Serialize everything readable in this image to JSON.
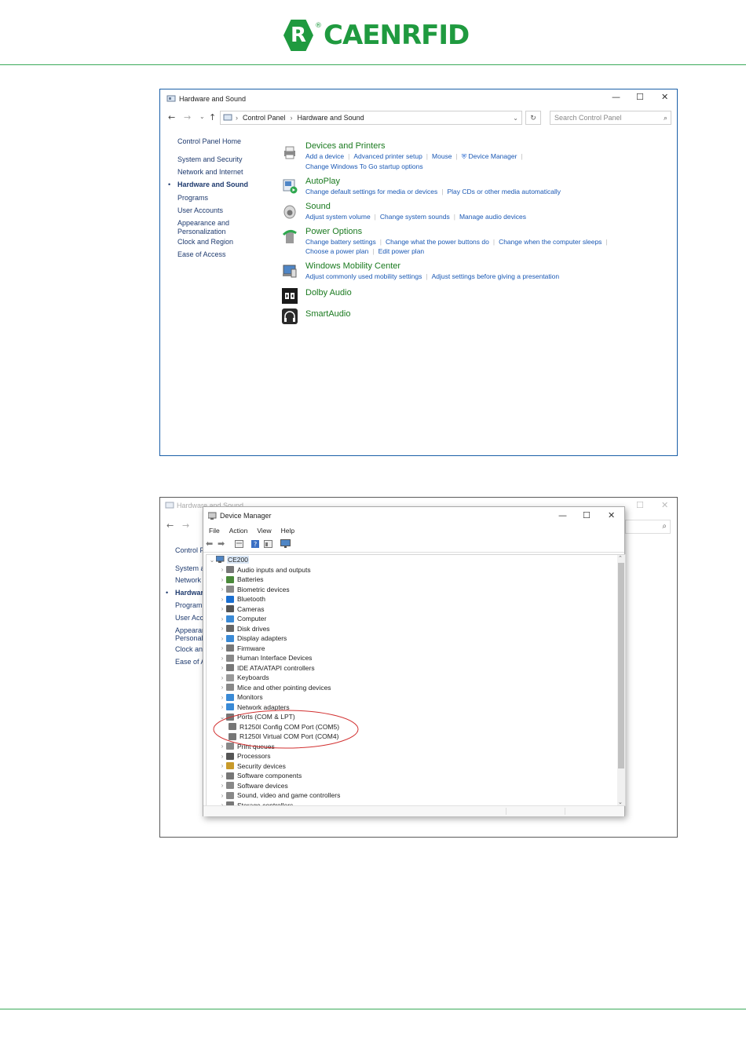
{
  "header": {
    "logo_letter": "R",
    "logo_reg": "®",
    "logo_text": "CAENRFID"
  },
  "control_panel": {
    "title": "Hardware and Sound",
    "breadcrumb": [
      "Control Panel",
      "Hardware and Sound"
    ],
    "search_placeholder": "Search Control Panel",
    "sidebar": [
      {
        "label": "Control Panel Home"
      },
      {
        "label": "System and Security"
      },
      {
        "label": "Network and Internet"
      },
      {
        "label": "Hardware and Sound",
        "active": true
      },
      {
        "label": "Programs"
      },
      {
        "label": "User Accounts"
      },
      {
        "label": "Appearance and Personalization"
      },
      {
        "label": "Clock and Region"
      },
      {
        "label": "Ease of Access"
      }
    ],
    "categories": [
      {
        "title": "Devices and Printers",
        "icon": "printer-icon",
        "links": [
          "Add a device",
          "Advanced printer setup",
          "Mouse",
          "Device Manager",
          "Change Windows To Go startup options"
        ]
      },
      {
        "title": "AutoPlay",
        "icon": "autoplay-icon",
        "links": [
          "Change default settings for media or devices",
          "Play CDs or other media automatically"
        ]
      },
      {
        "title": "Sound",
        "icon": "speaker-icon",
        "links": [
          "Adjust system volume",
          "Change system sounds",
          "Manage audio devices"
        ]
      },
      {
        "title": "Power Options",
        "icon": "battery-icon",
        "links": [
          "Change battery settings",
          "Change what the power buttons do",
          "Change when the computer sleeps",
          "Choose a power plan",
          "Edit power plan"
        ]
      },
      {
        "title": "Windows Mobility Center",
        "icon": "mobility-icon",
        "links": [
          "Adjust commonly used mobility settings",
          "Adjust settings before giving a presentation"
        ]
      },
      {
        "title": "Dolby Audio",
        "icon": "dolby-icon",
        "links": []
      },
      {
        "title": "SmartAudio",
        "icon": "headphones-icon",
        "links": []
      }
    ]
  },
  "background_window": {
    "title": "Hardware and Sound",
    "sidebar_fragments": [
      "Control P",
      "System a",
      "Network",
      "Hardwar",
      "Program",
      "User Acc",
      "Appearan",
      "Personali",
      "Clock an",
      "Ease of A"
    ]
  },
  "device_manager": {
    "title": "Device Manager",
    "menu": [
      "File",
      "Action",
      "View",
      "Help"
    ],
    "root": "CE200",
    "tree": [
      {
        "label": "Audio inputs and outputs",
        "color": "#777777"
      },
      {
        "label": "Batteries",
        "color": "#4a8a3a"
      },
      {
        "label": "Biometric devices",
        "color": "#888888"
      },
      {
        "label": "Bluetooth",
        "color": "#1a6fd1"
      },
      {
        "label": "Cameras",
        "color": "#555555"
      },
      {
        "label": "Computer",
        "color": "#3a8ad6"
      },
      {
        "label": "Disk drives",
        "color": "#666666"
      },
      {
        "label": "Display adapters",
        "color": "#3a8ad6"
      },
      {
        "label": "Firmware",
        "color": "#777777"
      },
      {
        "label": "Human Interface Devices",
        "color": "#888888"
      },
      {
        "label": "IDE ATA/ATAPI controllers",
        "color": "#777777"
      },
      {
        "label": "Keyboards",
        "color": "#999999"
      },
      {
        "label": "Mice and other pointing devices",
        "color": "#888888"
      },
      {
        "label": "Monitors",
        "color": "#3a8ad6"
      },
      {
        "label": "Network adapters",
        "color": "#3a8ad6"
      },
      {
        "label": "Ports (COM & LPT)",
        "color": "#777777",
        "expanded": true
      },
      {
        "label": "R1250I Config COM Port (COM5)",
        "color": "#777777",
        "child": true
      },
      {
        "label": "R1250I Virtual COM Port (COM4)",
        "color": "#777777",
        "child": true
      },
      {
        "label": "Print queues",
        "color": "#888888"
      },
      {
        "label": "Processors",
        "color": "#555555"
      },
      {
        "label": "Security devices",
        "color": "#c89a2a"
      },
      {
        "label": "Software components",
        "color": "#777777"
      },
      {
        "label": "Software devices",
        "color": "#888888"
      },
      {
        "label": "Sound, video and game controllers",
        "color": "#888888"
      },
      {
        "label": "Storage controllers",
        "color": "#777777"
      }
    ]
  }
}
